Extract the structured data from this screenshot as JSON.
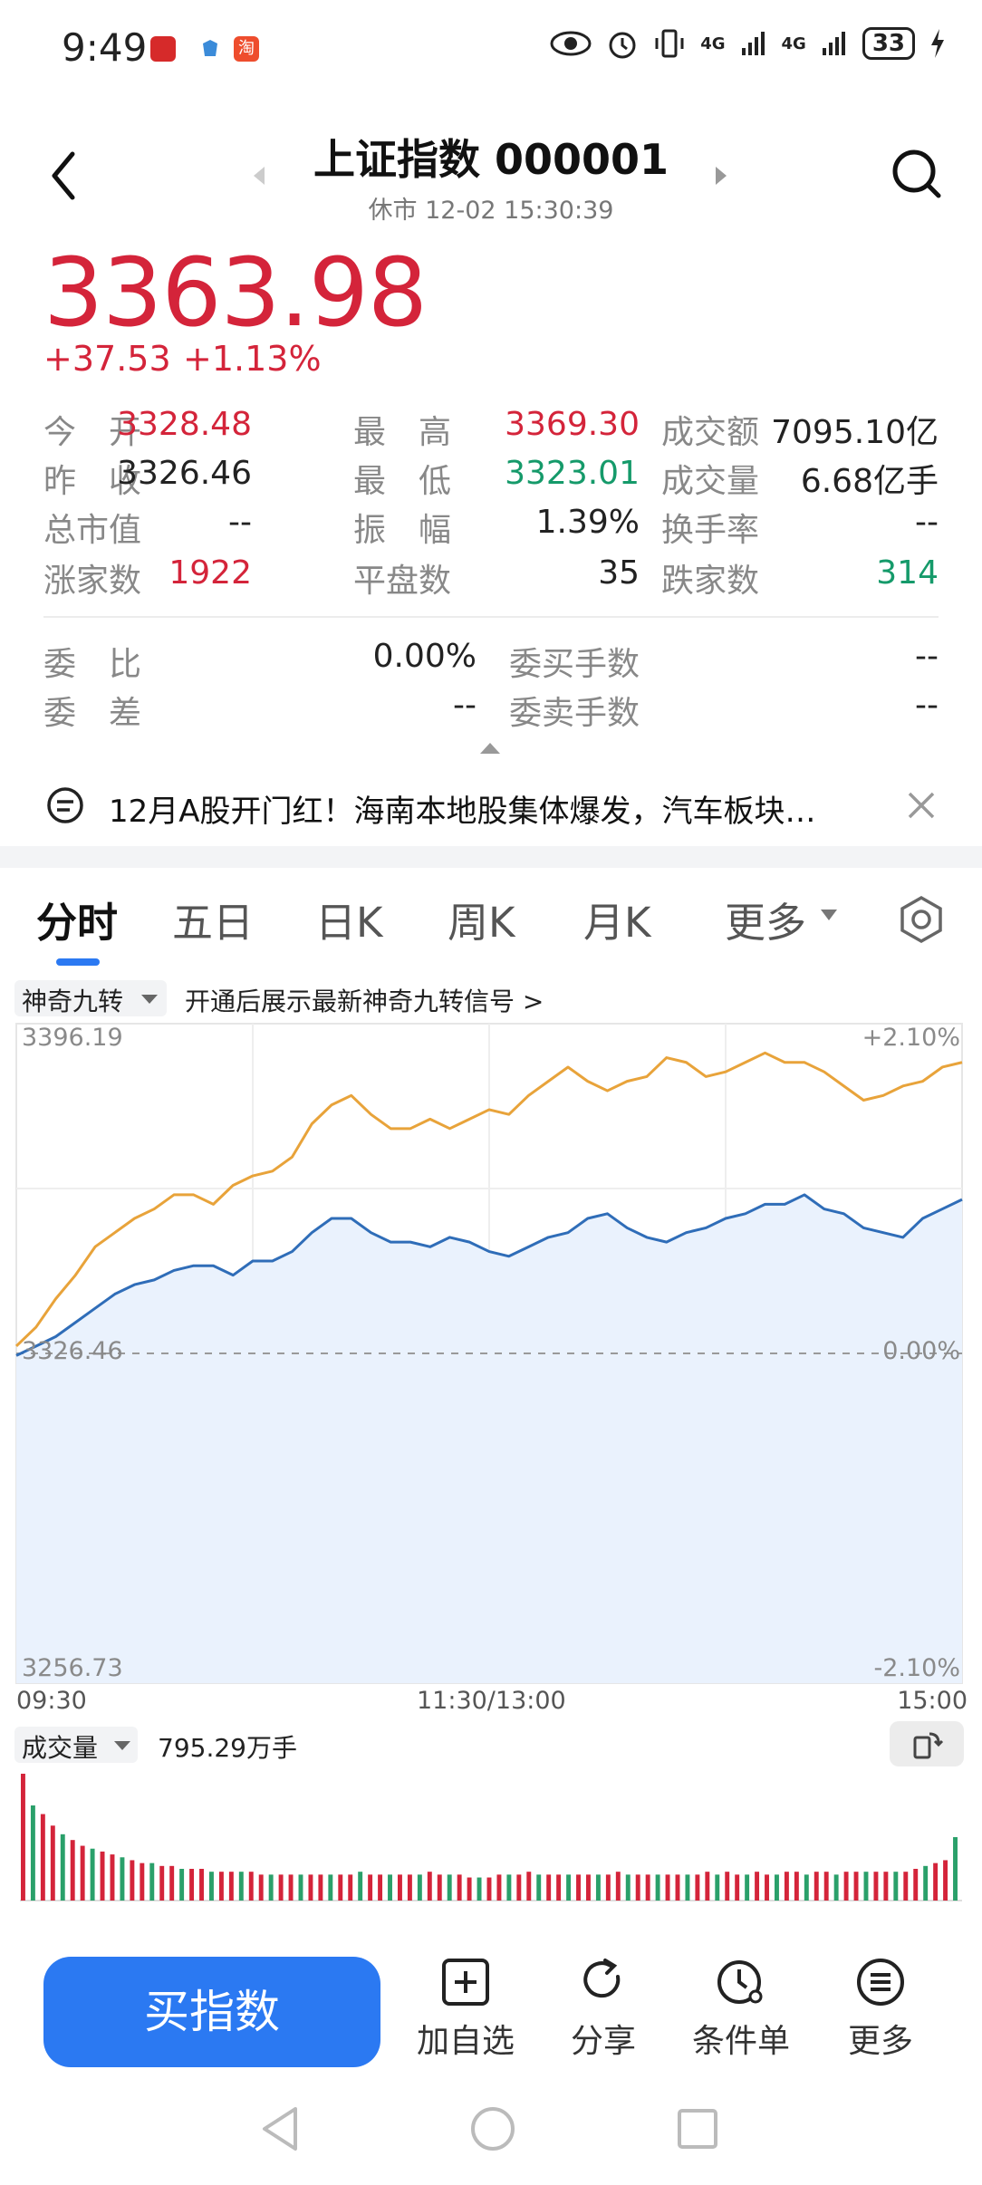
{
  "status_bar": {
    "time": "9:49",
    "network1": "4G",
    "network2": "4G",
    "battery": "33"
  },
  "header": {
    "title": "上证指数 000001",
    "subtitle": "休市 12-02 15:30:39"
  },
  "quote": {
    "price": "3363.98",
    "change": "+37.53",
    "change_pct": "+1.13%"
  },
  "stats": [
    {
      "label": "今　开",
      "value": "3328.48",
      "color": "red"
    },
    {
      "label": "最　高",
      "value": "3369.30",
      "color": "red"
    },
    {
      "label": "成交额",
      "value": "7095.10亿",
      "color": "dark"
    },
    {
      "label": "昨　收",
      "value": "3326.46",
      "color": "dark"
    },
    {
      "label": "最　低",
      "value": "3323.01",
      "color": "green"
    },
    {
      "label": "成交量",
      "value": "6.68亿手",
      "color": "dark"
    },
    {
      "label": "总市值",
      "value": "--",
      "color": "dark"
    },
    {
      "label": "振　幅",
      "value": "1.39%",
      "color": "dark"
    },
    {
      "label": "换手率",
      "value": "--",
      "color": "dark"
    },
    {
      "label": "涨家数",
      "value": "1922",
      "color": "red"
    },
    {
      "label": "平盘数",
      "value": "35",
      "color": "dark"
    },
    {
      "label": "跌家数",
      "value": "314",
      "color": "green"
    }
  ],
  "orders": [
    {
      "label": "委　比",
      "value": "0.00%"
    },
    {
      "label": "委买手数",
      "value": "--"
    },
    {
      "label": "委　差",
      "value": "--"
    },
    {
      "label": "委卖手数",
      "value": "--"
    }
  ],
  "news": {
    "text": "12月A股开门红！海南本地股集体爆发，汽车板块…"
  },
  "tabs": [
    "分时",
    "五日",
    "日K",
    "周K",
    "月K",
    "更多"
  ],
  "chart_controls": {
    "indicator": "神奇九转",
    "hint": "开通后展示最新神奇九转信号 >",
    "volume_label": "成交量",
    "volume_value": "795.29万手"
  },
  "chart_data": {
    "type": "line",
    "y_left_ticks": [
      "3396.19",
      "3326.46",
      "3256.73"
    ],
    "y_right_ticks": [
      "+2.10%",
      "0.00%",
      "-2.10%"
    ],
    "x_ticks": [
      "09:30",
      "11:30/13:00",
      "15:00"
    ],
    "ylim": [
      3256.73,
      3396.19
    ],
    "baseline": 3326.46,
    "series": [
      {
        "color": "#e8a33a",
        "values": [
          3328,
          3332,
          3338,
          3343,
          3349,
          3352,
          3355,
          3357,
          3360,
          3360,
          3358,
          3362,
          3364,
          3365,
          3368,
          3375,
          3379,
          3381,
          3377,
          3374,
          3374,
          3376,
          3374,
          3376,
          3378,
          3377,
          3381,
          3384,
          3387,
          3384,
          3382,
          3384,
          3385,
          3389,
          3388,
          3385,
          3386,
          3388,
          3390,
          3388,
          3388,
          3386,
          3383,
          3380,
          3381,
          3383,
          3384,
          3387,
          3388
        ]
      },
      {
        "color": "#2f6db8",
        "values": [
          3326,
          3328,
          3330,
          3333,
          3336,
          3339,
          3341,
          3342,
          3344,
          3345,
          3345,
          3343,
          3346,
          3346,
          3348,
          3352,
          3355,
          3355,
          3352,
          3350,
          3350,
          3349,
          3351,
          3350,
          3348,
          3347,
          3349,
          3351,
          3352,
          3355,
          3356,
          3353,
          3351,
          3350,
          3352,
          3353,
          3355,
          3356,
          3358,
          3358,
          3360,
          3357,
          3356,
          3353,
          3352,
          3351,
          3355,
          3357,
          3359
        ]
      }
    ],
    "volume": [
      44,
      33,
      30,
      26,
      23,
      21,
      19,
      18,
      17,
      16,
      15,
      14,
      13,
      13,
      12,
      12,
      11,
      11,
      11,
      10,
      10,
      10,
      10,
      10,
      9,
      9,
      9,
      9,
      9,
      9,
      9,
      9,
      9,
      9,
      10,
      9,
      9,
      9,
      9,
      9,
      9,
      10,
      9,
      9,
      9,
      8,
      8,
      8,
      9,
      9,
      9,
      10,
      9,
      9,
      9,
      9,
      9,
      9,
      9,
      9,
      10,
      9,
      9,
      9,
      9,
      9,
      9,
      9,
      9,
      10,
      9,
      10,
      9,
      9,
      10,
      9,
      9,
      10,
      10,
      9,
      10,
      10,
      9,
      10,
      10,
      10,
      10,
      10,
      10,
      10,
      11,
      12,
      13,
      14,
      22
    ]
  },
  "actions": [
    "加自选",
    "分享",
    "条件单",
    "更多"
  ],
  "buy_button": "买指数"
}
